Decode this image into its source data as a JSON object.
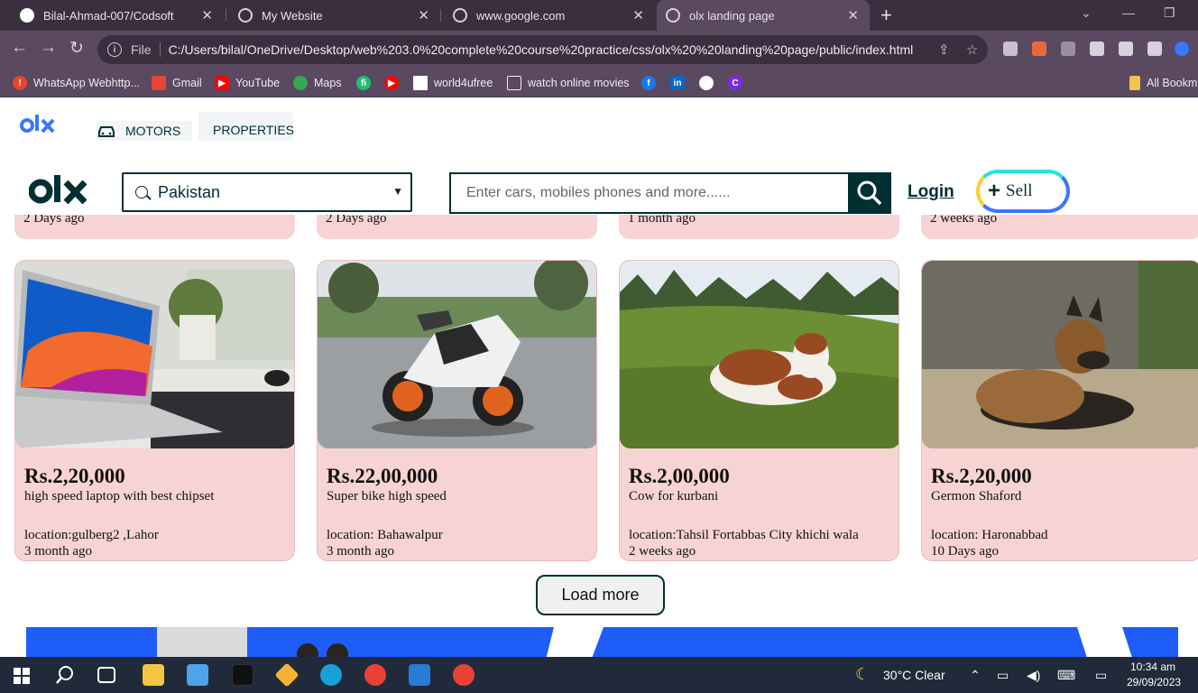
{
  "browser": {
    "tabs": [
      {
        "title": "Bilal-Ahmad-007/Codsoft"
      },
      {
        "title": "My Website"
      },
      {
        "title": "www.google.com"
      },
      {
        "title": "olx landing page"
      }
    ],
    "address": {
      "scheme": "File",
      "url": "C:/Users/bilal/OneDrive/Desktop/web%203.0%20complete%20course%20practice/css/olx%20%20landing%20page/public/index.html"
    },
    "bookmarks": [
      {
        "label": "WhatsApp Webhttp..."
      },
      {
        "label": "Gmail"
      },
      {
        "label": "YouTube"
      },
      {
        "label": "Maps"
      },
      {
        "label": "world4ufree"
      },
      {
        "label": "watch online movies"
      }
    ],
    "all_bookmarks": "All Bookm"
  },
  "page": {
    "categories": {
      "motors": "MOTORS",
      "properties": "PROPERTIES"
    },
    "location": {
      "value": "Pakistan"
    },
    "search": {
      "placeholder": "Enter cars, mobiles phones and more......"
    },
    "login": "Login",
    "sell": "Sell",
    "partial_cards": [
      "2 Days ago",
      "2 Days ago",
      "1 month ago",
      "2 weeks ago"
    ],
    "cards": [
      {
        "price": "Rs.2,20,000",
        "title": "high speed laptop with best chipset",
        "location": "location:gulberg2 ,Lahor",
        "ago": "3 month ago"
      },
      {
        "price": "Rs.22,00,000",
        "title": "Super bike high speed",
        "location": "location: Bahawalpur",
        "ago": "3 month ago"
      },
      {
        "price": "Rs.2,00,000",
        "title": "Cow for kurbani",
        "location": "location:Tahsil Fortabbas City khichi wala",
        "ago": "2 weeks ago"
      },
      {
        "price": "Rs.2,20,000",
        "title": "Germon Shaford",
        "location": "location: Haronabbad",
        "ago": "10 Days ago"
      }
    ],
    "load_more": "Load more"
  },
  "taskbar": {
    "weather": "30°C  Clear",
    "time": "10:34 am",
    "date": "29/09/2023"
  }
}
